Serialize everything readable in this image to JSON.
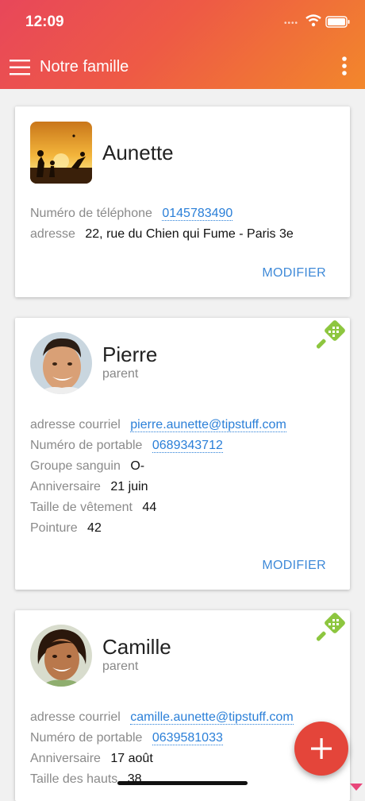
{
  "status_bar": {
    "time": "12:09",
    "dots": "••••"
  },
  "app_bar": {
    "title": "Notre famille"
  },
  "cards": [
    {
      "name": "Aunette",
      "role": "",
      "rows": [
        {
          "label": "Numéro de téléphone",
          "value": "0145783490",
          "link": true
        },
        {
          "label": "adresse",
          "value": "22, rue du Chien qui Fume - Paris 3e",
          "link": false
        }
      ],
      "action": "MODIFIER"
    },
    {
      "name": "Pierre",
      "role": "parent",
      "rows": [
        {
          "label": "adresse courriel",
          "value": "pierre.aunette@tipstuff.com",
          "link": true
        },
        {
          "label": "Numéro de portable",
          "value": "0689343712",
          "link": true
        },
        {
          "label": "Groupe sanguin",
          "value": "O-",
          "link": false
        },
        {
          "label": "Anniversaire",
          "value": "21 juin",
          "link": false
        },
        {
          "label": "Taille de vêtement",
          "value": "44",
          "link": false
        },
        {
          "label": "Pointure",
          "value": "42",
          "link": false
        }
      ],
      "action": "MODIFIER"
    },
    {
      "name": "Camille",
      "role": "parent",
      "rows": [
        {
          "label": "adresse courriel",
          "value": "camille.aunette@tipstuff.com",
          "link": true
        },
        {
          "label": "Numéro de portable",
          "value": "0639581033",
          "link": true
        },
        {
          "label": "Anniversaire",
          "value": "17 août",
          "link": false
        },
        {
          "label": "Taille des hauts",
          "value": "38",
          "link": false
        }
      ]
    }
  ],
  "fab": {
    "label": "+"
  },
  "colors": {
    "accent": "#2a7fd8",
    "fab": "#e4453a",
    "badge": "#8dc63f"
  },
  "icons": [
    "menu-icon",
    "more-vert-icon",
    "wifi-icon",
    "battery-icon",
    "tennis-racket-icon",
    "add-icon"
  ]
}
